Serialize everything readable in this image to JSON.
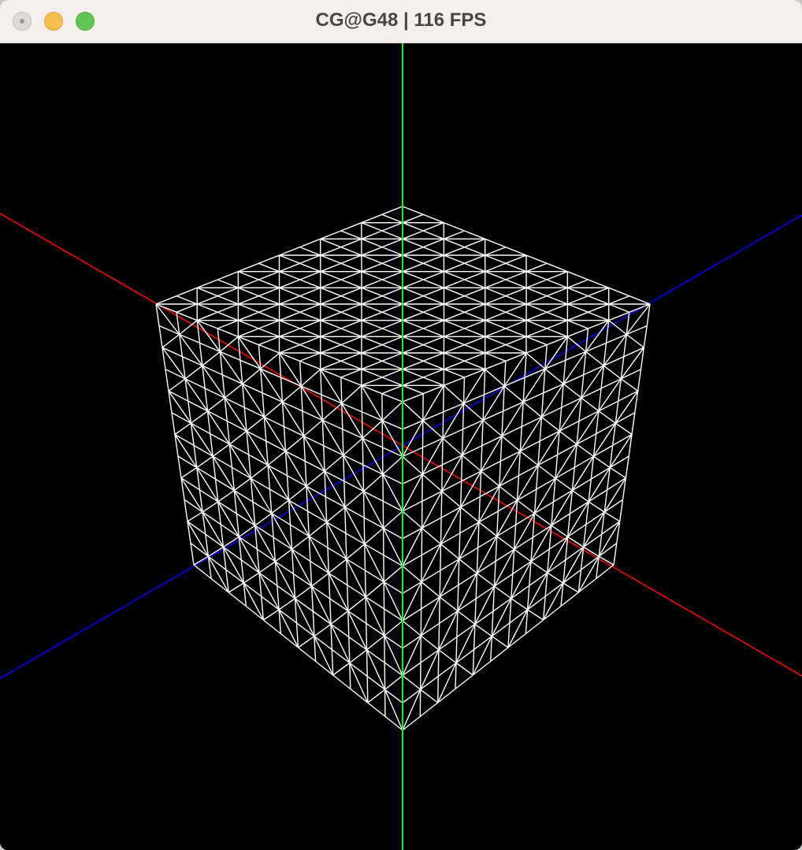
{
  "window": {
    "title": "CG@G48 | 116 FPS"
  },
  "scene": {
    "background_color": "#000000",
    "mesh_color": "#ffffff",
    "axis_colors": {
      "x": "#ff0000",
      "y": "#00ff00",
      "z": "#0000ff"
    },
    "render_mode": "wireframe",
    "model": "subdivided cube",
    "subdivisions_per_edge": 12
  }
}
